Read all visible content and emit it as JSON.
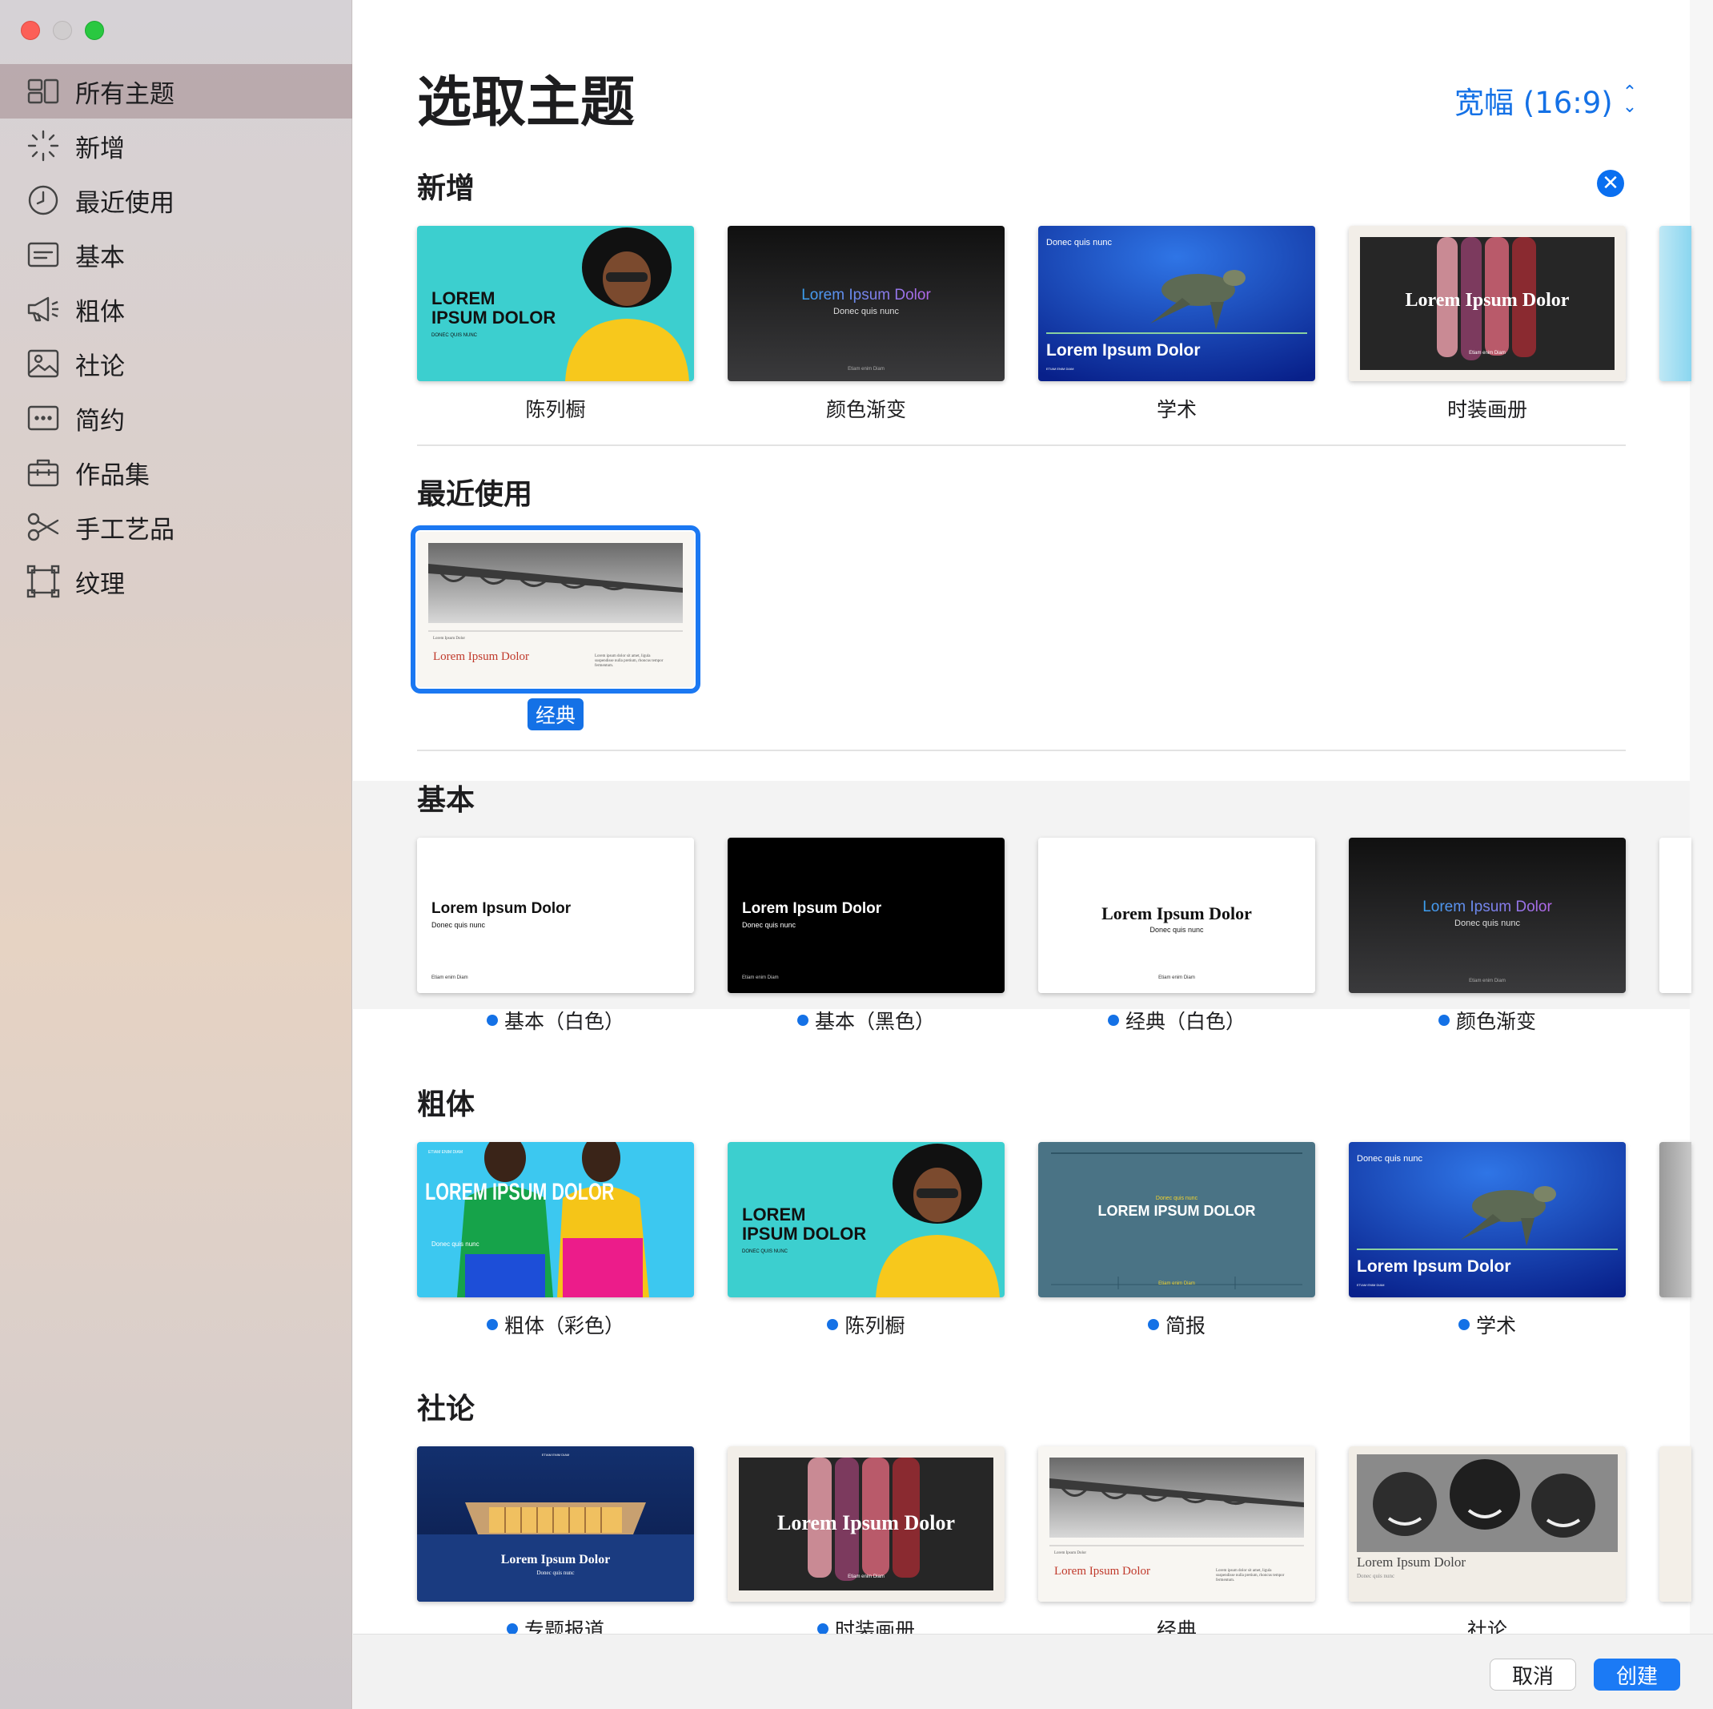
{
  "sidebar": {
    "items": [
      {
        "label": "所有主题",
        "icon": "grid-icon"
      },
      {
        "label": "新增",
        "icon": "sparkle-icon"
      },
      {
        "label": "最近使用",
        "icon": "clock-icon"
      },
      {
        "label": "基本",
        "icon": "text-box-icon"
      },
      {
        "label": "粗体",
        "icon": "megaphone-icon"
      },
      {
        "label": "社论",
        "icon": "photo-icon"
      },
      {
        "label": "简约",
        "icon": "ellipsis-box-icon"
      },
      {
        "label": "作品集",
        "icon": "briefcase-icon"
      },
      {
        "label": "手工艺品",
        "icon": "scissors-icon"
      },
      {
        "label": "纹理",
        "icon": "frame-icon"
      }
    ],
    "active_index": 0
  },
  "header": {
    "title": "选取主题",
    "aspect_label": "宽幅 (16:9)"
  },
  "sections": {
    "new": {
      "title": "新增",
      "themes": [
        "陈列橱",
        "颜色渐变",
        "学术",
        "时装画册"
      ]
    },
    "recent": {
      "title": "最近使用",
      "themes": [
        "经典"
      ]
    },
    "basic": {
      "title": "基本",
      "themes": [
        "基本（白色）",
        "基本（黑色）",
        "经典（白色）",
        "颜色渐变"
      ]
    },
    "bold": {
      "title": "粗体",
      "themes": [
        "粗体（彩色）",
        "陈列橱",
        "简报",
        "学术"
      ]
    },
    "editorial": {
      "title": "社论",
      "themes": [
        "专题报道",
        "时装画册",
        "经典",
        "社论"
      ]
    }
  },
  "thumb_text": {
    "showcase_1": "LOREM",
    "showcase_2": "IPSUM DOLOR",
    "showcase_3": "DONEC QUIS NUNC",
    "lorem": "Lorem Ipsum Dolor",
    "lorem_upper": "LOREM IPSUM DOLOR",
    "donec": "Donec quis nunc",
    "etiam": "Etiam enim Diam",
    "etiam_upper": "ETIAM ENIM DIAM",
    "body": "Lorem ipsum dolor sit amet, ligula suspendisse nulla pretium, rhoncus tempor fermentum."
  },
  "buttons": {
    "cancel": "取消",
    "create": "创建"
  },
  "colors": {
    "accent": "#1471e6",
    "selection": "#1b78f2"
  }
}
